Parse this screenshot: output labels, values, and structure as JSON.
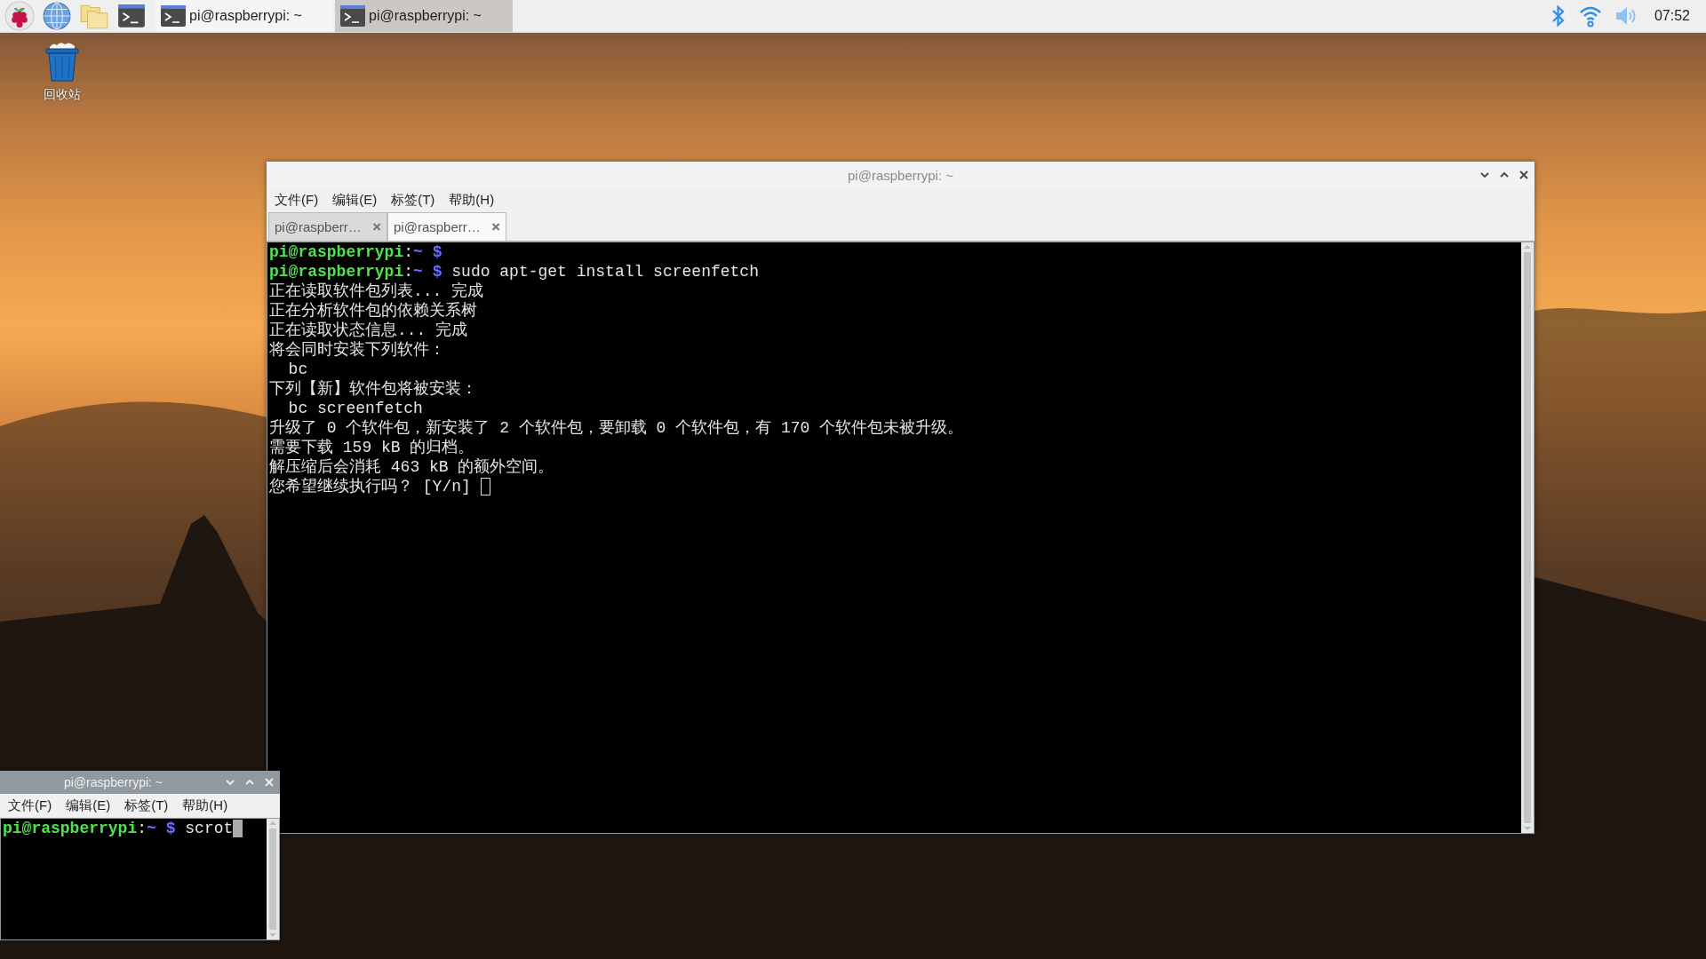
{
  "taskbar": {
    "launchers": [
      {
        "kind": "menu"
      },
      {
        "kind": "browser"
      },
      {
        "kind": "files"
      },
      {
        "kind": "terminal"
      }
    ],
    "tasks": [
      {
        "label": "pi@raspberrypi: ~",
        "selected": false
      },
      {
        "label": "pi@raspberrypi: ~",
        "selected": true
      }
    ],
    "clock": "07:52"
  },
  "desktop_icons": [
    {
      "label": "回收站"
    }
  ],
  "windows": [
    {
      "title": "pi@raspberrypi: ~",
      "active": false,
      "menu": [
        "文件(F)",
        "编辑(E)",
        "标签(T)",
        "帮助(H)"
      ],
      "tabs": [
        {
          "label": "pi@raspberr…",
          "selected": false
        },
        {
          "label": "pi@raspberr…",
          "selected": true
        }
      ],
      "lines": [
        {
          "kind": "prompt",
          "user_host": "pi@raspberrypi",
          "separator": ":",
          "path": "~",
          "symbol": "$"
        },
        {
          "kind": "prompt",
          "user_host": "pi@raspberrypi",
          "separator": ":",
          "path": "~",
          "symbol": "$",
          "command": "sudo apt-get install screenfetch"
        },
        {
          "kind": "output",
          "text": "正在读取软件包列表... 完成"
        },
        {
          "kind": "output",
          "text": "正在分析软件包的依赖关系树"
        },
        {
          "kind": "output",
          "text": "正在读取状态信息... 完成"
        },
        {
          "kind": "output",
          "text": "将会同时安装下列软件："
        },
        {
          "kind": "output",
          "text": "  bc"
        },
        {
          "kind": "output",
          "text": "下列【新】软件包将被安装："
        },
        {
          "kind": "output",
          "text": "  bc screenfetch"
        },
        {
          "kind": "output",
          "text": "升级了 0 个软件包，新安装了 2 个软件包，要卸载 0 个软件包，有 170 个软件包未被升级。"
        },
        {
          "kind": "output",
          "text": "需要下载 159 kB 的归档。"
        },
        {
          "kind": "output",
          "text": "解压缩后会消耗 463 kB 的额外空间。"
        },
        {
          "kind": "output",
          "text": "您希望继续执行吗？ [Y/n] ",
          "cursor": true
        }
      ]
    },
    {
      "title": "pi@raspberrypi: ~",
      "active": true,
      "menu": [
        "文件(F)",
        "编辑(E)",
        "标签(T)",
        "帮助(H)"
      ],
      "lines": [
        {
          "kind": "prompt",
          "user_host": "pi@raspberrypi",
          "separator": ":",
          "path": "~",
          "symbol": "$",
          "command": "scrot",
          "cursor": true
        }
      ]
    }
  ]
}
